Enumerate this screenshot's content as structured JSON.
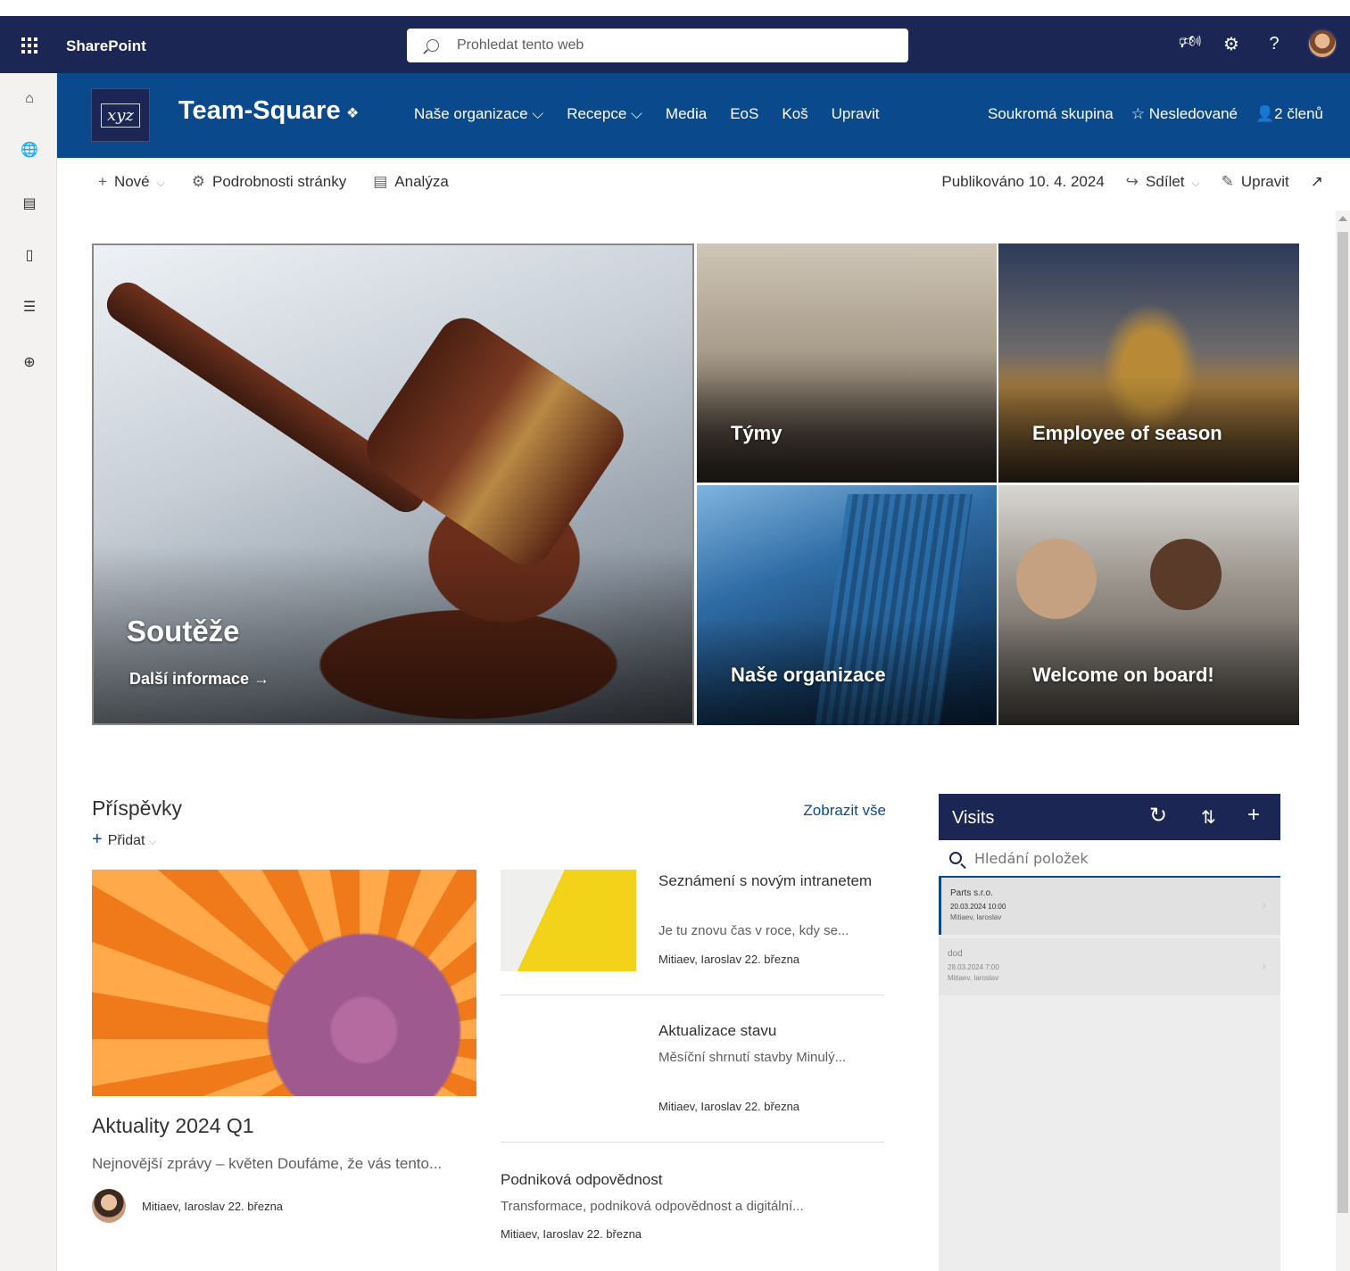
{
  "suite": {
    "app_name": "SharePoint",
    "search_placeholder": "Prohledat tento web",
    "icons": [
      "megaphone-icon",
      "gear-icon",
      "help-icon",
      "avatar"
    ]
  },
  "left_rail": [
    "home-icon",
    "globe-icon",
    "news-icon",
    "file-icon",
    "lists-icon",
    "add-circle-icon"
  ],
  "site": {
    "logo_text": "xyz",
    "title": "Team-Square",
    "nav": [
      "Naše organizace",
      "Recepce",
      "Media",
      "EoS",
      "Koš",
      "Upravit"
    ],
    "privacy": "Soukromá skupina",
    "follow": "Nesledované",
    "members": "2 členů"
  },
  "command_bar": {
    "new": "Nové",
    "page_details": "Podrobnosti stránky",
    "analytics": "Analýza",
    "published": "Publikováno 10. 4. 2024",
    "share": "Sdílet",
    "edit": "Upravit"
  },
  "hero": {
    "main": {
      "title": "Soutěže",
      "link": "Další informace"
    },
    "tiles": [
      "Týmy",
      "Employee of season",
      "Naše organizace",
      "Welcome on board!"
    ]
  },
  "news": {
    "title": "Příspěvky",
    "see_all": "Zobrazit vše",
    "add": "Přidat",
    "featured": {
      "title": "Aktuality 2024 Q1",
      "desc": "Nejnovější zprávy – květen Doufáme, že vás tento...",
      "author": "Mitiaev, Iaroslav",
      "date": "22. března"
    },
    "items": [
      {
        "title": "Seznámení s novým intranetem",
        "desc": "Je tu znovu čas v roce, kdy se...",
        "author": "Mitiaev, Iaroslav",
        "date": "22. března"
      },
      {
        "title": "Aktualizace stavu",
        "desc": "Měsíční shrnutí stavby Minulý...",
        "author": "Mitiaev, Iaroslav",
        "date": "22. března"
      },
      {
        "title": "Podniková odpovědnost",
        "desc": "Transformace, podniková odpovědnost a digitální...",
        "author": "Mitiaev, Iaroslav",
        "date": "22. března"
      }
    ]
  },
  "visits": {
    "title": "Visits",
    "search_placeholder": "Hledání položek",
    "items": [
      {
        "name": "Parts s.r.o.",
        "datetime": "20.03.2024 10:00",
        "person": "Mitiaev, Iaroslav"
      },
      {
        "name": "dod",
        "datetime": "28.03.2024 7:00",
        "person": "Mitiaev, Iaroslav"
      }
    ]
  }
}
